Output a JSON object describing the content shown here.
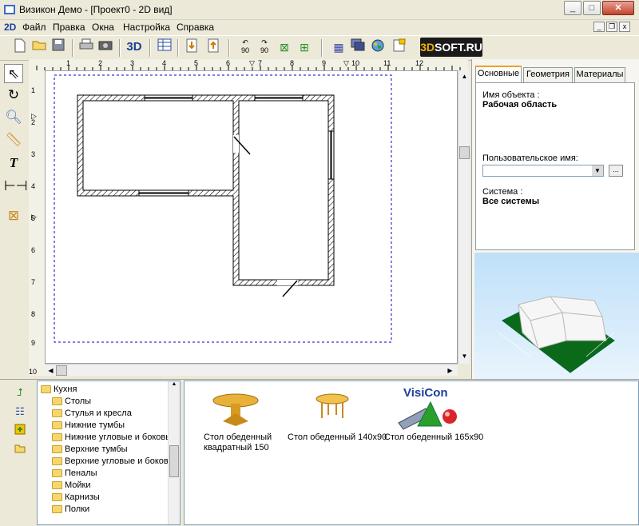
{
  "window": {
    "title": "Визикон Демо - [Проект0 - 2D вид]"
  },
  "menu": {
    "mode_label": "2D",
    "items": [
      "Файл",
      "Правка",
      "Окна",
      "Настройка",
      "Справка"
    ]
  },
  "toolbar": {
    "view3d_label": "3D",
    "rotate_left_label": "90",
    "rotate_right_label": "90",
    "logo_prefix": "3D",
    "logo_suffix": "SOFT.RU"
  },
  "rulers": {
    "top": [
      "1",
      "2",
      "3",
      "4",
      "5",
      "6",
      "7",
      "8",
      "9",
      "10",
      "11",
      "12"
    ],
    "left": [
      "1",
      "2",
      "3",
      "4",
      "5",
      "6",
      "7",
      "8",
      "9",
      "10"
    ]
  },
  "properties": {
    "tabs": [
      "Основные",
      "Геометрия",
      "Материалы"
    ],
    "active_tab": "Основные",
    "object_name_label": "Имя объекта :",
    "object_name_value": "Рабочая область",
    "user_name_label": "Пользовательское имя:",
    "user_name_value": "",
    "more_button": "...",
    "system_label": "Система :",
    "system_value": "Все системы"
  },
  "tree": {
    "root": "Кухня",
    "items": [
      "Столы",
      "Стулья и кресла",
      "Нижние тумбы",
      "Нижние угловые и боковые",
      "Верхние тумбы",
      "Верхние  угловые и боковые",
      "Пеналы",
      "Мойки",
      "Карнизы",
      "Полки"
    ]
  },
  "catalog": {
    "items": [
      {
        "line1": "Стол обеденный",
        "line2": "квадратный 150"
      },
      {
        "line1": "Стол обеденный 140x90",
        "line2": ""
      },
      {
        "line1": "Стол обеденный 165x90",
        "line2": ""
      }
    ],
    "watermark": "VisiCon"
  },
  "colors": {
    "window_bg": "#ece9d8",
    "accent_tab": "#f0a02a",
    "dashed_boundary": "#0000cc",
    "preview_sky": "#bfe0f8",
    "preview_floor": "#0a6a1a"
  }
}
